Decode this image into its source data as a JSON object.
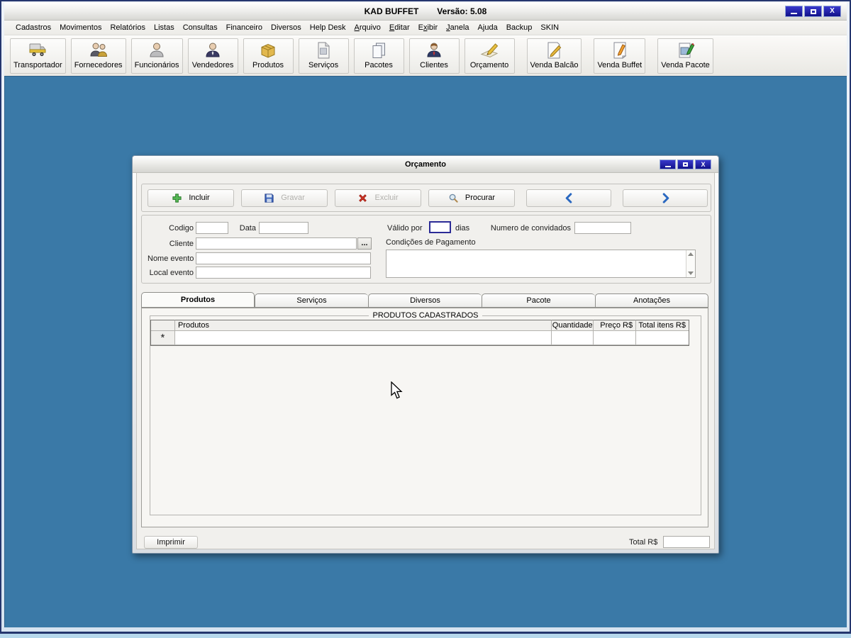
{
  "window": {
    "title": "KAD BUFFET",
    "version": "Versão: 5.08"
  },
  "menu": {
    "items": [
      {
        "label": "Cadastros"
      },
      {
        "label": "Movimentos"
      },
      {
        "label": "Relatórios"
      },
      {
        "label": "Listas"
      },
      {
        "label": "Consultas"
      },
      {
        "label": "Financeiro"
      },
      {
        "label": "Diversos"
      },
      {
        "label": "Help Desk"
      },
      {
        "label": "Arquivo",
        "accel": "A"
      },
      {
        "label": "Editar",
        "accel": "E"
      },
      {
        "label": "Exibir",
        "accel": "x"
      },
      {
        "label": "Janela",
        "accel": "J"
      },
      {
        "label": "Ajuda"
      },
      {
        "label": "Backup"
      },
      {
        "label": "SKIN"
      }
    ]
  },
  "toolbar": {
    "buttons": [
      {
        "label": "Transportador",
        "icon": "truck-icon"
      },
      {
        "label": "Fornecedores",
        "icon": "suppliers-icon"
      },
      {
        "label": "Funcionários",
        "icon": "employee-icon"
      },
      {
        "label": "Vendedores",
        "icon": "salesperson-icon"
      },
      {
        "label": "Produtos",
        "icon": "product-box-icon"
      },
      {
        "label": "Serviços",
        "icon": "services-document-icon"
      },
      {
        "label": "Pacotes",
        "icon": "packages-icon"
      },
      {
        "label": "Clientes",
        "icon": "client-icon"
      },
      {
        "label": "Orçamento",
        "icon": "budget-pencil-icon"
      },
      {
        "label": "Venda Balcão",
        "icon": "counter-sale-icon"
      },
      {
        "label": "Venda Buffet",
        "icon": "buffet-sale-icon"
      },
      {
        "label": "Venda Pacote",
        "icon": "package-sale-icon"
      }
    ]
  },
  "dialog": {
    "title": "Orçamento",
    "actions": [
      {
        "name": "incluir-button",
        "label": "Incluir",
        "icon": "plus-icon",
        "enabled": true
      },
      {
        "name": "gravar-button",
        "label": "Gravar",
        "icon": "save-icon",
        "enabled": false
      },
      {
        "name": "excluir-button",
        "label": "Excluir",
        "icon": "delete-icon",
        "enabled": false
      },
      {
        "name": "procurar-button",
        "label": "Procurar",
        "icon": "search-icon",
        "enabled": true
      },
      {
        "name": "previous-record-button",
        "label": "",
        "icon": "chevron-left-icon",
        "enabled": true
      },
      {
        "name": "next-record-button",
        "label": "",
        "icon": "chevron-right-icon",
        "enabled": true
      }
    ],
    "form": {
      "codigo_label": "Codigo",
      "codigo_value": "",
      "data_label": "Data",
      "data_value": "",
      "cliente_label": "Cliente",
      "cliente_value": "",
      "browse_label": "...",
      "nome_evento_label": "Nome evento",
      "nome_evento_value": "",
      "local_evento_label": "Local evento",
      "local_evento_value": "",
      "valido_por_label": "Válido por",
      "valido_por_value": "",
      "dias_label": "dias",
      "convidados_label": "Numero de convidados",
      "convidados_value": "",
      "condicoes_label": "Condições de Pagamento",
      "condicoes_value": ""
    },
    "tabs": [
      {
        "label": "Produtos",
        "active": true
      },
      {
        "label": "Serviços",
        "active": false
      },
      {
        "label": "Diversos",
        "active": false
      },
      {
        "label": "Pacote",
        "active": false
      },
      {
        "label": "Anotações",
        "active": false
      }
    ],
    "grid": {
      "caption": "PRODUTOS CADASTRADOS",
      "columns": [
        "Produtos",
        "Quantidade",
        "Preço R$",
        "Total itens R$"
      ],
      "new_row_marker": "*",
      "rows": []
    },
    "footer": {
      "print_label": "Imprimir",
      "total_label": "Total R$",
      "total_value": ""
    }
  },
  "colors": {
    "client_bg": "#3A79A7",
    "titlebar_button": "#1717AE",
    "accent_blue": "#2A68C0"
  }
}
